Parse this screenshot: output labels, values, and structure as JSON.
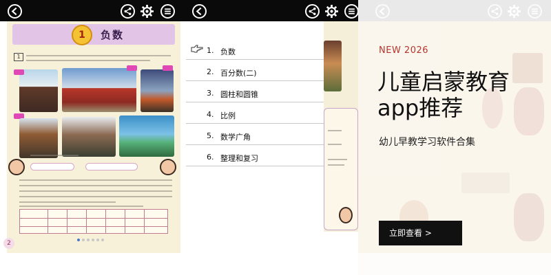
{
  "phone1": {
    "appbar": {
      "back_icon": "back-arrow-icon",
      "share_icon": "share-icon",
      "settings_icon": "gear-icon",
      "menu_icon": "menu-icon"
    },
    "lesson": {
      "number": "1",
      "title": "负数"
    },
    "page_number": "2",
    "carousel": {
      "count": 6,
      "active_index": 0
    }
  },
  "phone2": {
    "toc": [
      {
        "num": "1.",
        "title": "负数",
        "selected": true
      },
      {
        "num": "2.",
        "title": "百分数(二)"
      },
      {
        "num": "3.",
        "title": "圆柱和圆锥"
      },
      {
        "num": "4.",
        "title": "比例"
      },
      {
        "num": "5.",
        "title": "数学广角"
      },
      {
        "num": "6.",
        "title": "整理和复习"
      }
    ]
  },
  "promo": {
    "eyebrow": "NEW 2026",
    "title": "儿童启蒙教育app推荐",
    "subtitle": "幼儿早教学习软件合集",
    "cta": "立即查看 >"
  },
  "colors": {
    "appbar": "#0a0a0a",
    "accent": "#b5342c",
    "lesson_banner": "#e2c4e6",
    "page_bg": "#f7f1da"
  }
}
